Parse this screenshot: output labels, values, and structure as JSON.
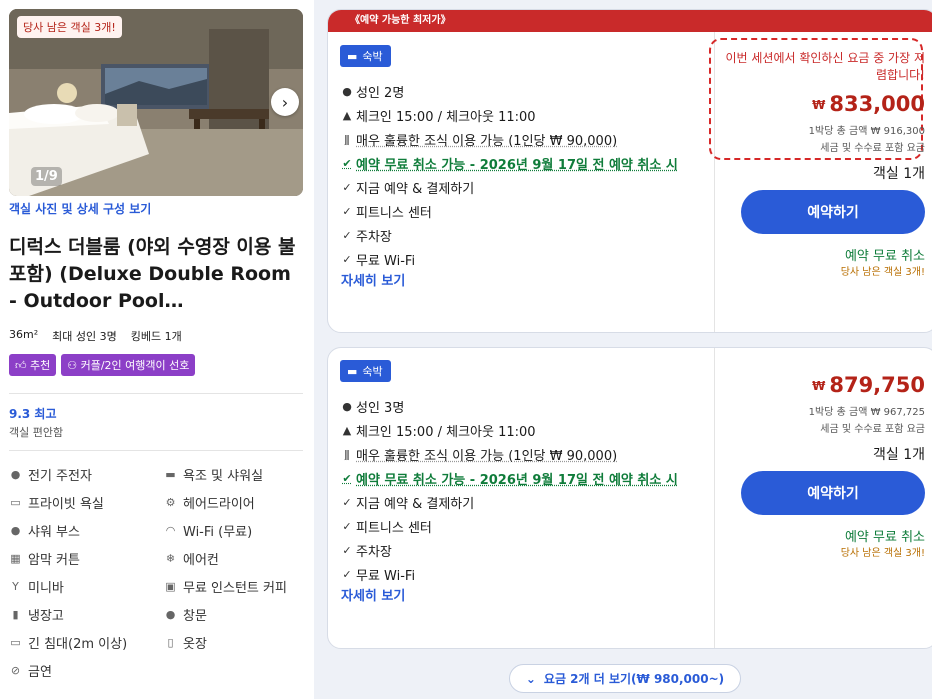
{
  "gallery": {
    "badge": "당사 남은 객실 3개!",
    "counter": "1/9",
    "link": "객실 사진 및 상세 구성 보기"
  },
  "room": {
    "title": "디럭스 더블룸 (야외 수영장 이용 불포함) (Deluxe Double Room - Outdoor Pool…",
    "size": "36m²",
    "max_guests": "최대 성인 3명",
    "bed": "킹베드 1개",
    "tags": [
      "추천",
      "커플/2인 여행객이 선호"
    ],
    "rating": "9.3 최고",
    "rating_sub": "객실 편안함"
  },
  "amenities": [
    {
      "icon": "bidet-icon",
      "label": "전기 주전자"
    },
    {
      "icon": "bathtub-icon",
      "label": "욕조 및 샤워실"
    },
    {
      "icon": "bath-icon",
      "label": "프라이빗 욕실"
    },
    {
      "icon": "hairdryer-icon",
      "label": "헤어드라이어"
    },
    {
      "icon": "shower-icon",
      "label": "샤워 부스"
    },
    {
      "icon": "wifi-icon",
      "label": "Wi-Fi (무료)"
    },
    {
      "icon": "curtain-icon",
      "label": "암막 커튼"
    },
    {
      "icon": "snowflake-icon",
      "label": "에어컨"
    },
    {
      "icon": "cocktail-icon",
      "label": "미니바"
    },
    {
      "icon": "coffee-icon",
      "label": "무료 인스턴트 커피"
    },
    {
      "icon": "fridge-icon",
      "label": "냉장고"
    },
    {
      "icon": "window-icon",
      "label": "창문"
    },
    {
      "icon": "bed-icon",
      "label": "긴 침대(2m 이상)"
    },
    {
      "icon": "wardrobe-icon",
      "label": "옷장"
    },
    {
      "icon": "no-smoking-icon",
      "label": "금연"
    }
  ],
  "offers": [
    {
      "banner": "《예약 가능한 최저가》",
      "stay_tag": "숙박",
      "guests": "성인 2명",
      "checkin": "체크인 15:00 / 체크아웃 11:00",
      "breakfast": "매우 훌륭한 조식 이용 가능 (1인당 ₩ 90,000)",
      "cancel": "예약 무료 취소 가능 - 2026년 9월 17일 전 예약 취소 시",
      "perks": [
        "지금 예약 & 결제하기",
        "피트니스 센터",
        "주차장",
        "무료 Wi-Fi"
      ],
      "more": "자세히 보기",
      "highlight": "이번 세션에서 확인하신 요금 중 가장 저렴합니다!",
      "currency": "₩",
      "price": "833,000",
      "total": "1박당 총 금액 ₩ 916,300",
      "tax_note": "세금 및 수수료 포함 요금",
      "rooms": "객실 1개",
      "book": "예약하기",
      "free_cancel": "예약 무료 취소",
      "left": "당사 남은 객실 3개!"
    },
    {
      "stay_tag": "숙박",
      "guests": "성인 3명",
      "checkin": "체크인 15:00 / 체크아웃 11:00",
      "breakfast": "매우 훌륭한 조식 이용 가능 (1인당 ₩ 90,000)",
      "cancel": "예약 무료 취소 가능 - 2026년 9월 17일 전 예약 취소 시",
      "perks": [
        "지금 예약 & 결제하기",
        "피트니스 센터",
        "주차장",
        "무료 Wi-Fi"
      ],
      "more": "자세히 보기",
      "currency": "₩",
      "price": "879,750",
      "total": "1박당 총 금액 ₩ 967,725",
      "tax_note": "세금 및 수수료 포함 요금",
      "rooms": "객실 1개",
      "book": "예약하기",
      "free_cancel": "예약 무료 취소",
      "left": "당사 남은 객실 3개!"
    }
  ],
  "more_rates": "요금 2개 더 보기(₩ 980,000~)"
}
